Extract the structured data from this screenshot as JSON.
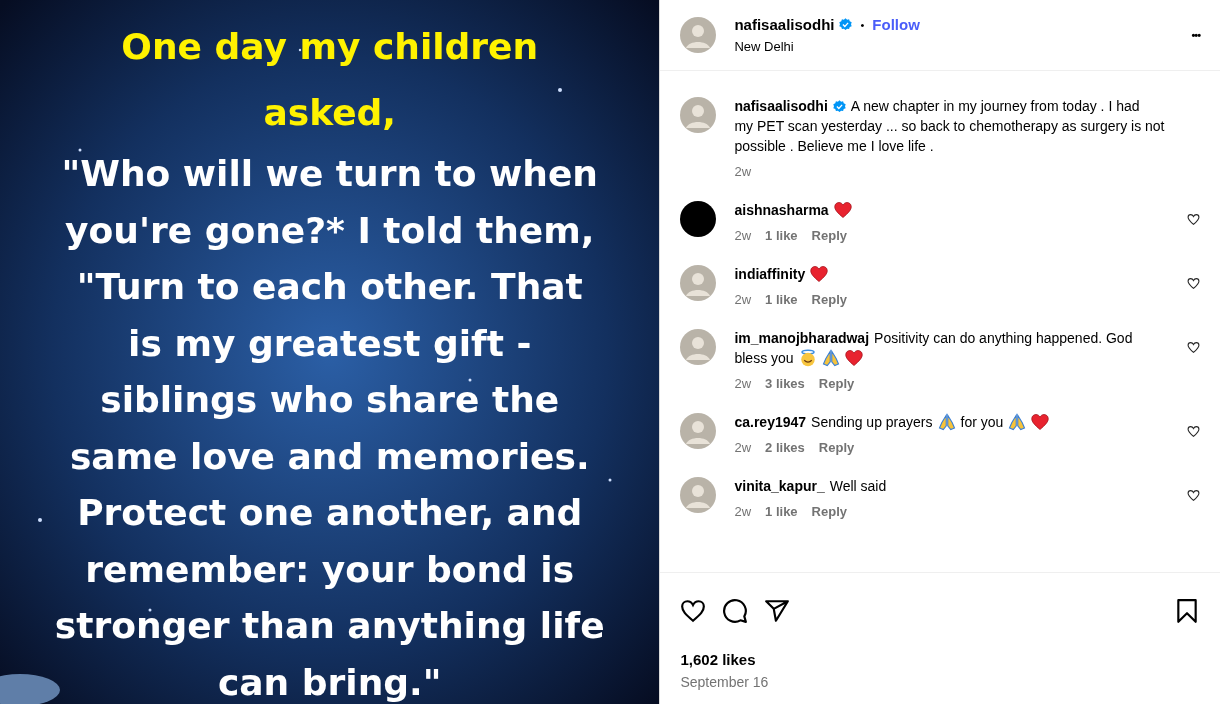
{
  "post_image": {
    "heading": [
      "One day my children",
      "asked,"
    ],
    "body": [
      "\"Who will we turn to when",
      "you're gone?* I told them,",
      "\"Turn to each other. That",
      "is my greatest gift -",
      "siblings who share the",
      "same love and memories.",
      "Protect one another, and",
      "remember: your bond is",
      "stronger than anything life",
      "can bring.\""
    ]
  },
  "header": {
    "username": "nafisaalisodhi",
    "verified": true,
    "separator": "•",
    "follow": "Follow",
    "location": "New Delhi",
    "more": "•••"
  },
  "caption": {
    "username": "nafisaalisodhi",
    "verified": true,
    "lines": [
      "A new chapter in my journey from today . I had",
      "my PET scan yesterday ... so back to chemotherapy as surgery is not",
      "possible . Believe me I love life ."
    ],
    "time": "2w"
  },
  "comments": [
    {
      "username": "aishnasharma",
      "lines": [
        [
          {
            "kind": "heart"
          }
        ]
      ],
      "time": "2w",
      "likes": "1 like",
      "reply": "Reply"
    },
    {
      "username": "indiaffinity",
      "lines": [
        [
          {
            "kind": "heart"
          }
        ]
      ],
      "time": "2w",
      "likes": "1 like",
      "reply": "Reply"
    },
    {
      "username": "im_manojbharadwaj",
      "lines": [
        [
          {
            "kind": "text",
            "text": "Positivity can do anything happened. God"
          }
        ],
        [
          {
            "kind": "text",
            "text": "bless you"
          },
          {
            "kind": "smiley"
          },
          {
            "kind": "pray"
          },
          {
            "kind": "heart"
          }
        ]
      ],
      "time": "2w",
      "likes": "3 likes",
      "reply": "Reply"
    },
    {
      "username": "ca.rey1947",
      "lines": [
        [
          {
            "kind": "text",
            "text": "Sending up prayers"
          },
          {
            "kind": "pray"
          },
          {
            "kind": "text",
            "text": "for you"
          },
          {
            "kind": "pray"
          },
          {
            "kind": "heart"
          }
        ]
      ],
      "time": "2w",
      "likes": "2 likes",
      "reply": "Reply"
    },
    {
      "username": "vinita_kapur_",
      "lines": [
        [
          {
            "kind": "text",
            "text": "Well said"
          }
        ]
      ],
      "time": "2w",
      "likes": "1 like",
      "reply": "Reply"
    }
  ],
  "likes": "1,602 likes",
  "date": "September 16"
}
